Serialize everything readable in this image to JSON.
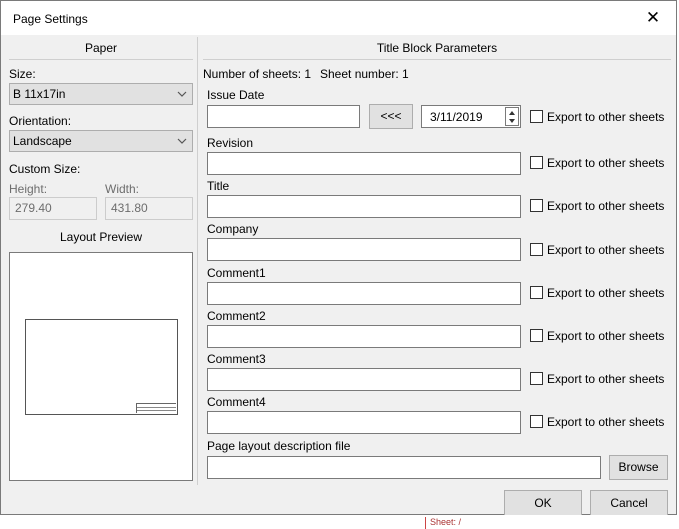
{
  "window": {
    "title": "Page Settings",
    "close_glyph": "✕"
  },
  "paper": {
    "section_title": "Paper",
    "size_label": "Size:",
    "size_value": "B 11x17in",
    "orientation_label": "Orientation:",
    "orientation_value": "Landscape",
    "custom_size_label": "Custom Size:",
    "height_label": "Height:",
    "height_value": "279.40",
    "width_label": "Width:",
    "width_value": "431.80",
    "preview_title": "Layout Preview"
  },
  "title_block": {
    "section_title": "Title Block Parameters",
    "sheets_count": "Number of sheets: 1",
    "sheet_number": "Sheet number: 1",
    "issue_date_label": "Issue Date",
    "issue_date_value": "",
    "copy_date_button": "<<<",
    "date_value": "3/11/2019",
    "export_label": "Export to other sheets",
    "fields": [
      {
        "label": "Revision",
        "value": ""
      },
      {
        "label": "Title",
        "value": ""
      },
      {
        "label": "Company",
        "value": ""
      },
      {
        "label": "Comment1",
        "value": ""
      },
      {
        "label": "Comment2",
        "value": ""
      },
      {
        "label": "Comment3",
        "value": ""
      },
      {
        "label": "Comment4",
        "value": ""
      }
    ],
    "layout_file_label": "Page layout description file",
    "layout_file_value": "",
    "browse_button": "Browse"
  },
  "footer": {
    "ok_button": "OK",
    "cancel_button": "Cancel"
  },
  "background": {
    "sheet_marker": "Sheet: /"
  },
  "icons": {
    "combo_arrow": "chevron-down-icon",
    "spin_up": "triangle-up-icon",
    "spin_down": "triangle-down-icon"
  }
}
